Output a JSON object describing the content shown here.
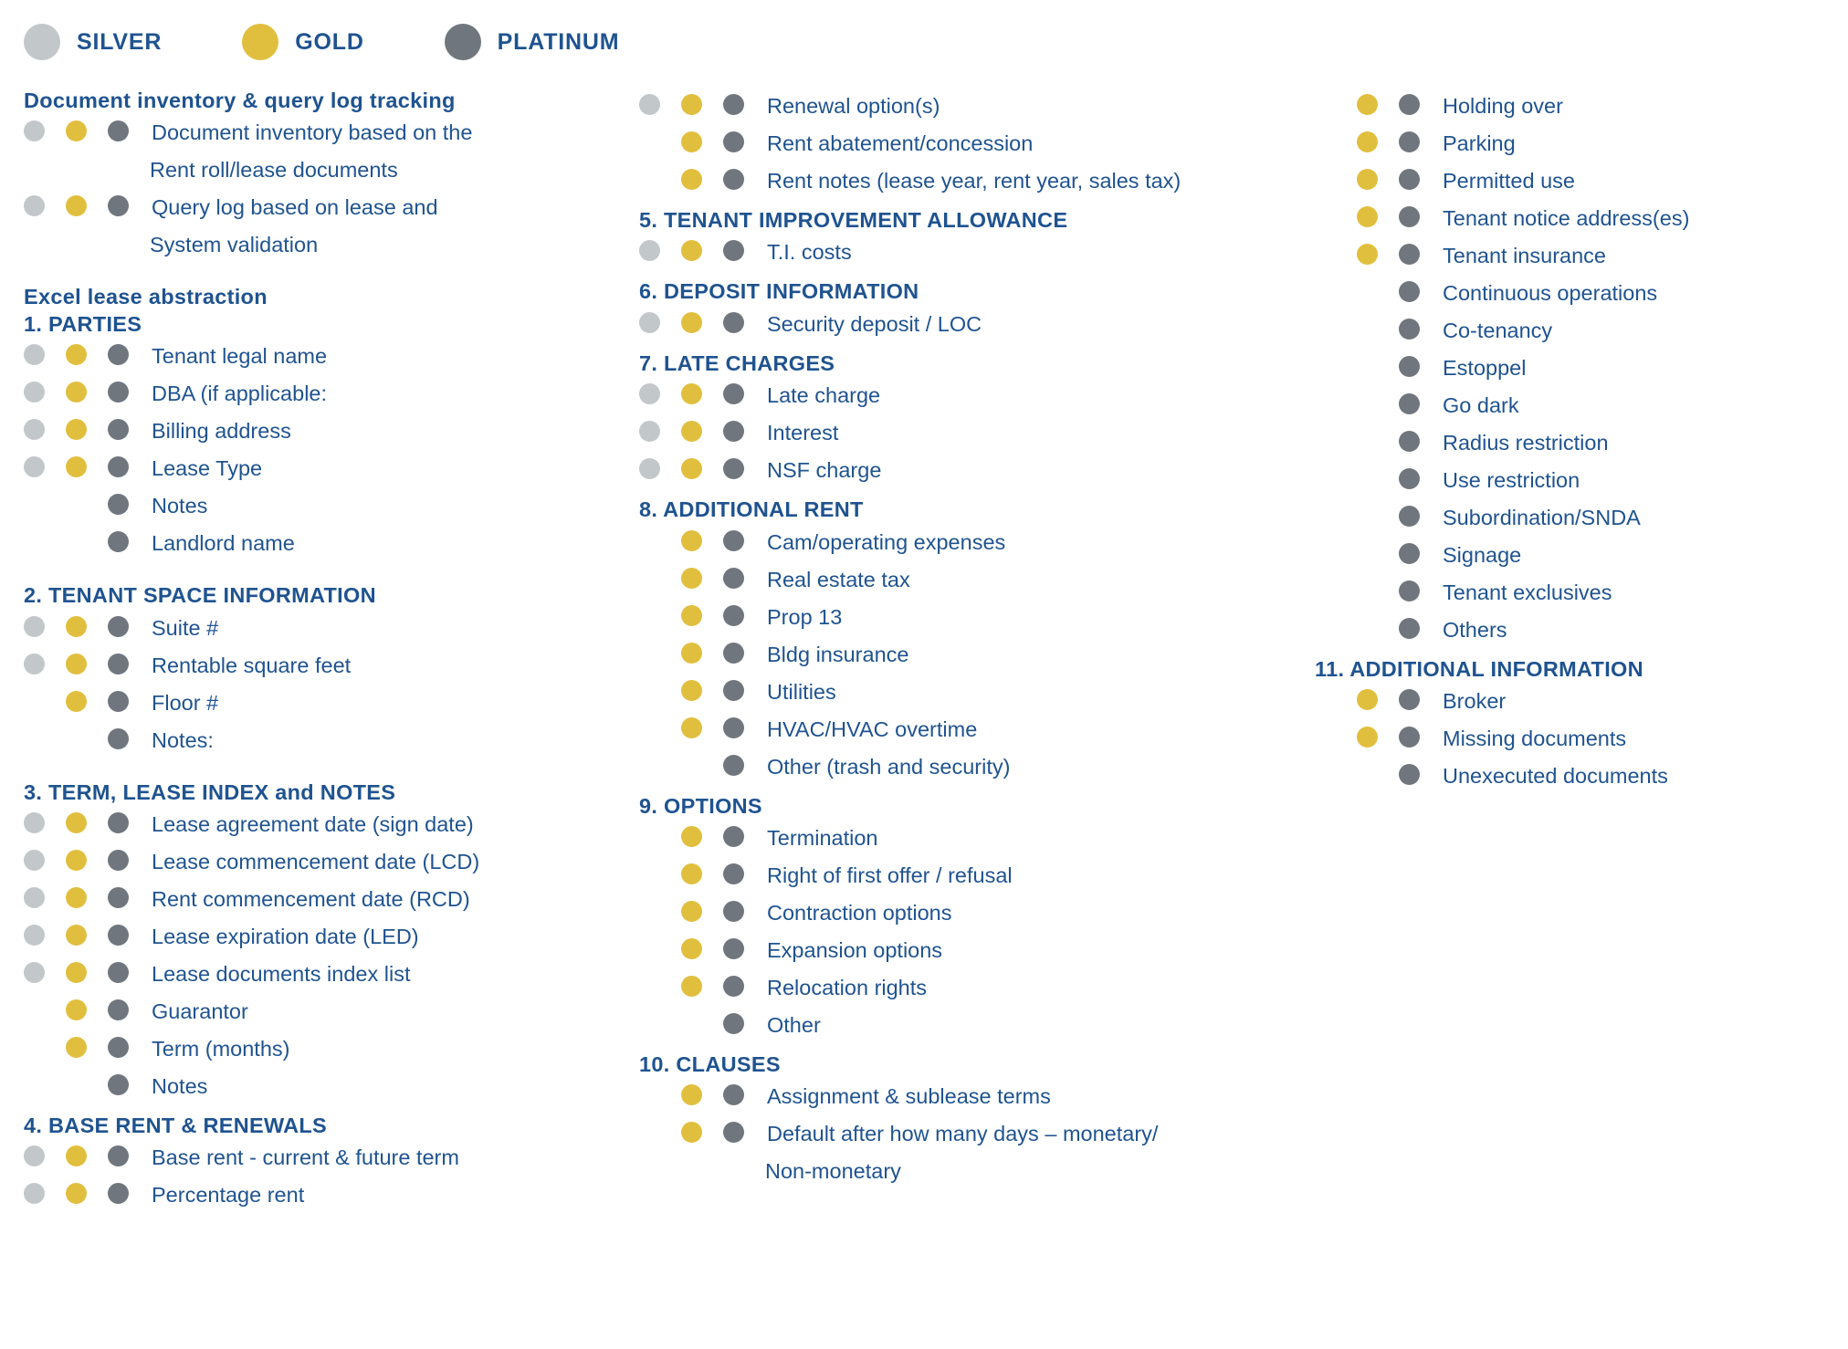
{
  "colors": {
    "silver": "#c2c7ca",
    "gold": "#e1bf3e",
    "platinum": "#6f767e",
    "text_blue": "#1f5390",
    "background": "#ffffff"
  },
  "legend": {
    "items": [
      {
        "label": "SILVER",
        "tier": "silver"
      },
      {
        "label": "GOLD",
        "tier": "gold"
      },
      {
        "label": "PLATINUM",
        "tier": "platinum"
      }
    ]
  },
  "columns": [
    {
      "id": "column-1",
      "blocks": [
        {
          "type": "heading",
          "text": "Document inventory & query log tracking"
        },
        {
          "type": "row",
          "tiers": [
            "silver",
            "gold",
            "platinum"
          ],
          "label": "Document inventory based on the",
          "continuation": "Rent roll/lease documents"
        },
        {
          "type": "row",
          "tiers": [
            "silver",
            "gold",
            "platinum"
          ],
          "label": "Query log based on lease and",
          "continuation": "System validation"
        },
        {
          "type": "gap",
          "size": "md"
        },
        {
          "type": "heading",
          "text": "Excel lease abstraction"
        },
        {
          "type": "heading",
          "text": "1. PARTIES"
        },
        {
          "type": "row",
          "tiers": [
            "silver",
            "gold",
            "platinum"
          ],
          "label": "Tenant legal name"
        },
        {
          "type": "row",
          "tiers": [
            "silver",
            "gold",
            "platinum"
          ],
          "label": "DBA (if applicable:"
        },
        {
          "type": "row",
          "tiers": [
            "silver",
            "gold",
            "platinum"
          ],
          "label": "Billing address"
        },
        {
          "type": "row",
          "tiers": [
            "silver",
            "gold",
            "platinum"
          ],
          "label": "Lease Type"
        },
        {
          "type": "row",
          "tiers": [
            "none",
            "none",
            "platinum"
          ],
          "label": "Notes"
        },
        {
          "type": "row",
          "tiers": [
            "none",
            "none",
            "platinum"
          ],
          "label": "Landlord name"
        },
        {
          "type": "gap",
          "size": "md"
        },
        {
          "type": "heading",
          "text": "2. TENANT SPACE INFORMATION"
        },
        {
          "type": "row",
          "tiers": [
            "silver",
            "gold",
            "platinum"
          ],
          "label": "Suite #"
        },
        {
          "type": "row",
          "tiers": [
            "silver",
            "gold",
            "platinum"
          ],
          "label": "Rentable square feet"
        },
        {
          "type": "row",
          "tiers": [
            "none",
            "gold",
            "platinum"
          ],
          "label": "Floor #"
        },
        {
          "type": "row",
          "tiers": [
            "none",
            "none",
            "platinum"
          ],
          "label": "Notes:"
        },
        {
          "type": "gap",
          "size": "md"
        },
        {
          "type": "heading",
          "text": "3. TERM, LEASE INDEX and NOTES"
        },
        {
          "type": "row",
          "tiers": [
            "silver",
            "gold",
            "platinum"
          ],
          "label": "Lease agreement date (sign date)"
        },
        {
          "type": "row",
          "tiers": [
            "silver",
            "gold",
            "platinum"
          ],
          "label": "Lease commencement date (LCD)"
        },
        {
          "type": "row",
          "tiers": [
            "silver",
            "gold",
            "platinum"
          ],
          "label": "Rent commencement date (RCD)"
        },
        {
          "type": "row",
          "tiers": [
            "silver",
            "gold",
            "platinum"
          ],
          "label": "Lease expiration date (LED)"
        },
        {
          "type": "row",
          "tiers": [
            "silver",
            "gold",
            "platinum"
          ],
          "label": "Lease documents index list"
        },
        {
          "type": "row",
          "tiers": [
            "none",
            "gold",
            "platinum"
          ],
          "label": "Guarantor"
        },
        {
          "type": "row",
          "tiers": [
            "none",
            "gold",
            "platinum"
          ],
          "label": "Term (months)"
        },
        {
          "type": "row",
          "tiers": [
            "none",
            "none",
            "platinum"
          ],
          "label": "Notes"
        },
        {
          "type": "gap",
          "size": "sm"
        },
        {
          "type": "heading",
          "text": "4. BASE RENT & RENEWALS"
        },
        {
          "type": "row",
          "tiers": [
            "silver",
            "gold",
            "platinum"
          ],
          "label": "Base rent - current & future term"
        },
        {
          "type": "row",
          "tiers": [
            "silver",
            "gold",
            "platinum"
          ],
          "label": "Percentage rent"
        }
      ]
    },
    {
      "id": "column-2",
      "blocks": [
        {
          "type": "row",
          "tiers": [
            "silver",
            "gold",
            "platinum"
          ],
          "label": "Renewal option(s)"
        },
        {
          "type": "row",
          "tiers": [
            "none",
            "gold",
            "platinum"
          ],
          "label": "Rent abatement/concession"
        },
        {
          "type": "row",
          "tiers": [
            "none",
            "gold",
            "platinum"
          ],
          "label": "Rent notes (lease year, rent year, sales tax)"
        },
        {
          "type": "gap",
          "size": "sm"
        },
        {
          "type": "heading",
          "text": "5. TENANT IMPROVEMENT ALLOWANCE"
        },
        {
          "type": "row",
          "tiers": [
            "silver",
            "gold",
            "platinum"
          ],
          "label": "T.I. costs"
        },
        {
          "type": "gap",
          "size": "sm"
        },
        {
          "type": "heading",
          "text": "6. DEPOSIT INFORMATION"
        },
        {
          "type": "row",
          "tiers": [
            "silver",
            "gold",
            "platinum"
          ],
          "label": "Security deposit / LOC"
        },
        {
          "type": "gap",
          "size": "sm"
        },
        {
          "type": "heading",
          "text": "7. LATE CHARGES"
        },
        {
          "type": "row",
          "tiers": [
            "silver",
            "gold",
            "platinum"
          ],
          "label": "Late charge"
        },
        {
          "type": "row",
          "tiers": [
            "silver",
            "gold",
            "platinum"
          ],
          "label": "Interest"
        },
        {
          "type": "row",
          "tiers": [
            "silver",
            "gold",
            "platinum"
          ],
          "label": "NSF charge"
        },
        {
          "type": "gap",
          "size": "sm"
        },
        {
          "type": "heading",
          "text": "8. ADDITIONAL RENT"
        },
        {
          "type": "row",
          "tiers": [
            "none",
            "gold",
            "platinum"
          ],
          "label": "Cam/operating expenses"
        },
        {
          "type": "row",
          "tiers": [
            "none",
            "gold",
            "platinum"
          ],
          "label": "Real estate tax"
        },
        {
          "type": "row",
          "tiers": [
            "none",
            "gold",
            "platinum"
          ],
          "label": "Prop 13"
        },
        {
          "type": "row",
          "tiers": [
            "none",
            "gold",
            "platinum"
          ],
          "label": "Bldg insurance"
        },
        {
          "type": "row",
          "tiers": [
            "none",
            "gold",
            "platinum"
          ],
          "label": "Utilities"
        },
        {
          "type": "row",
          "tiers": [
            "none",
            "gold",
            "platinum"
          ],
          "label": "HVAC/HVAC overtime"
        },
        {
          "type": "row",
          "tiers": [
            "none",
            "none",
            "platinum"
          ],
          "label": "Other (trash and security)"
        },
        {
          "type": "gap",
          "size": "sm"
        },
        {
          "type": "heading",
          "text": "9. OPTIONS"
        },
        {
          "type": "row",
          "tiers": [
            "none",
            "gold",
            "platinum"
          ],
          "label": "Termination"
        },
        {
          "type": "row",
          "tiers": [
            "none",
            "gold",
            "platinum"
          ],
          "label": "Right of first offer / refusal"
        },
        {
          "type": "row",
          "tiers": [
            "none",
            "gold",
            "platinum"
          ],
          "label": "Contraction options"
        },
        {
          "type": "row",
          "tiers": [
            "none",
            "gold",
            "platinum"
          ],
          "label": "Expansion options"
        },
        {
          "type": "row",
          "tiers": [
            "none",
            "gold",
            "platinum"
          ],
          "label": "Relocation rights"
        },
        {
          "type": "row",
          "tiers": [
            "none",
            "none",
            "platinum"
          ],
          "label": "Other"
        },
        {
          "type": "gap",
          "size": "sm"
        },
        {
          "type": "heading",
          "text": "10. CLAUSES"
        },
        {
          "type": "row",
          "tiers": [
            "none",
            "gold",
            "platinum"
          ],
          "label": "Assignment & sublease terms"
        },
        {
          "type": "row",
          "tiers": [
            "none",
            "gold",
            "platinum"
          ],
          "label": "Default after how many days – monetary/",
          "continuation": "Non-monetary"
        }
      ]
    },
    {
      "id": "column-3",
      "blocks": [
        {
          "type": "row",
          "tiers": [
            "none",
            "gold",
            "platinum"
          ],
          "label": "Holding over"
        },
        {
          "type": "row",
          "tiers": [
            "none",
            "gold",
            "platinum"
          ],
          "label": "Parking"
        },
        {
          "type": "row",
          "tiers": [
            "none",
            "gold",
            "platinum"
          ],
          "label": "Permitted use"
        },
        {
          "type": "row",
          "tiers": [
            "none",
            "gold",
            "platinum"
          ],
          "label": "Tenant notice address(es)"
        },
        {
          "type": "row",
          "tiers": [
            "none",
            "gold",
            "platinum"
          ],
          "label": "Tenant insurance"
        },
        {
          "type": "row",
          "tiers": [
            "none",
            "none",
            "platinum"
          ],
          "label": "Continuous operations"
        },
        {
          "type": "row",
          "tiers": [
            "none",
            "none",
            "platinum"
          ],
          "label": "Co-tenancy"
        },
        {
          "type": "row",
          "tiers": [
            "none",
            "none",
            "platinum"
          ],
          "label": "Estoppel"
        },
        {
          "type": "row",
          "tiers": [
            "none",
            "none",
            "platinum"
          ],
          "label": "Go dark"
        },
        {
          "type": "row",
          "tiers": [
            "none",
            "none",
            "platinum"
          ],
          "label": "Radius restriction"
        },
        {
          "type": "row",
          "tiers": [
            "none",
            "none",
            "platinum"
          ],
          "label": "Use restriction"
        },
        {
          "type": "row",
          "tiers": [
            "none",
            "none",
            "platinum"
          ],
          "label": "Subordination/SNDA"
        },
        {
          "type": "row",
          "tiers": [
            "none",
            "none",
            "platinum"
          ],
          "label": "Signage"
        },
        {
          "type": "row",
          "tiers": [
            "none",
            "none",
            "platinum"
          ],
          "label": "Tenant exclusives"
        },
        {
          "type": "row",
          "tiers": [
            "none",
            "none",
            "platinum"
          ],
          "label": "Others"
        },
        {
          "type": "gap",
          "size": "sm"
        },
        {
          "type": "heading",
          "text": "11. ADDITIONAL INFORMATION"
        },
        {
          "type": "row",
          "tiers": [
            "none",
            "gold",
            "platinum"
          ],
          "label": "Broker"
        },
        {
          "type": "row",
          "tiers": [
            "none",
            "gold",
            "platinum"
          ],
          "label": "Missing documents"
        },
        {
          "type": "row",
          "tiers": [
            "none",
            "none",
            "platinum"
          ],
          "label": "Unexecuted documents"
        }
      ]
    }
  ]
}
